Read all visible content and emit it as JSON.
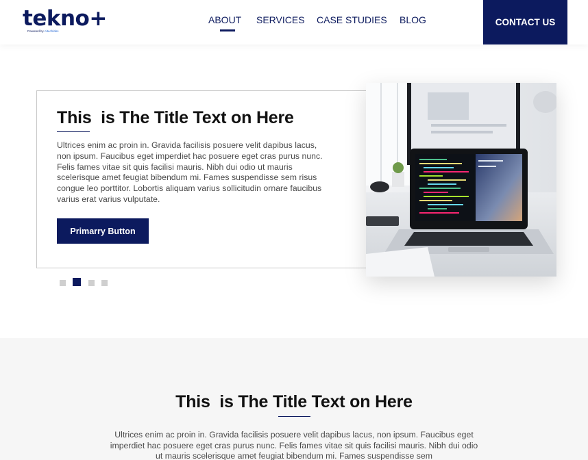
{
  "header": {
    "logo_text": "tekno+",
    "logo_sub_prefix": "Powered by ",
    "logo_sub_brand": "Altechlabs",
    "nav": [
      {
        "label": "ABOUT",
        "active": true
      },
      {
        "label": "SERVICES",
        "active": false
      },
      {
        "label": "CASE STUDIES",
        "active": false
      },
      {
        "label": "BLOG",
        "active": false
      }
    ],
    "contact_label": "CONTACT US"
  },
  "hero": {
    "title": "This  is The Title Text on Here",
    "body": "Ultrices enim ac proin in. Gravida facilisis posuere velit dapibus lacus, non ipsum. Faucibus eget imperdiet hac posuere eget cras purus nunc. Felis fames vitae sit quis facilisi mauris. Nibh dui odio ut mauris scelerisque amet feugiat bibendum mi. Fames suspendisse sem risus congue leo porttitor. Lobortis aliquam varius sollicitudin ornare faucibus varius erat varius vulputate.",
    "button_label": "Primarry Button",
    "image_icon": "laptop-workspace-photo",
    "carousel": {
      "count": 4,
      "active_index": 1
    }
  },
  "section2": {
    "title": "This  is The Title Text on Here",
    "body": "Ultrices enim ac proin in. Gravida facilisis posuere velit dapibus lacus, non ipsum. Faucibus eget imperdiet hac posuere eget cras purus nunc. Felis fames vitae sit quis facilisi mauris. Nibh dui odio ut mauris scelerisque amet feugiat bibendum mi. Fames suspendisse sem"
  },
  "colors": {
    "brand_navy": "#0c1a5e",
    "section_bg": "#f6f6f6",
    "dot_inactive": "#cfcfcf"
  }
}
